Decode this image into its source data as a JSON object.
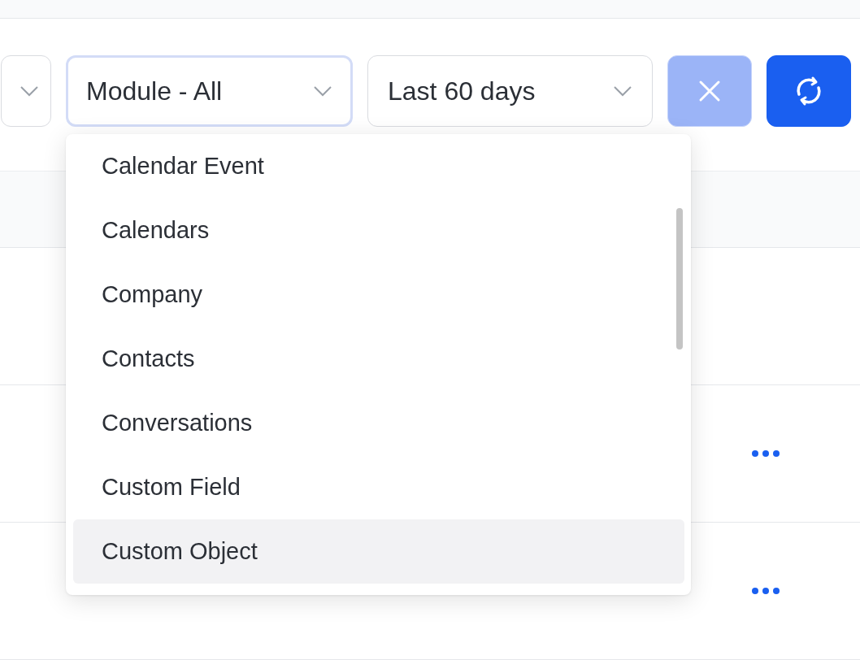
{
  "filters": [
    {
      "focused": false
    },
    {
      "value": "Module - All",
      "focused": true
    },
    {
      "value": "Last 60 days",
      "focused": false
    }
  ],
  "clear_button": {
    "disabled": true
  },
  "table": {
    "rows": [
      {
        "actions": false
      },
      {
        "actions": true
      },
      {
        "actions": true
      }
    ]
  },
  "dropdown": {
    "options": [
      {
        "label": "Calendar Event",
        "highlighted": false
      },
      {
        "label": "Calendars",
        "highlighted": false
      },
      {
        "label": "Company",
        "highlighted": false
      },
      {
        "label": "Contacts",
        "highlighted": false
      },
      {
        "label": "Conversations",
        "highlighted": false
      },
      {
        "label": "Custom Field",
        "highlighted": false
      },
      {
        "label": "Custom Object",
        "highlighted": true
      }
    ]
  }
}
